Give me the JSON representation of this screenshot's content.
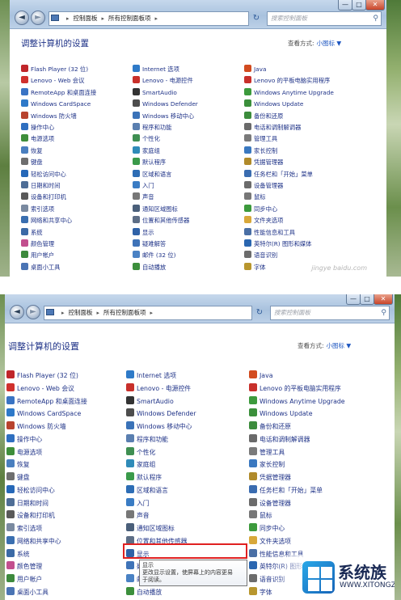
{
  "nav": {
    "crumbs": [
      "控制面板",
      "所有控制面板项"
    ],
    "search_placeholder": "搜索控制面板"
  },
  "header": {
    "title": "调整计算机的设置",
    "view_label": "查看方式:",
    "view_value": "小图标",
    "view_arrow": "▼"
  },
  "columns": [
    [
      {
        "label": "Flash Player (32 位)",
        "icon": "flash-player-icon",
        "color": "#c0262a"
      },
      {
        "label": "Lenovo - Web 会议",
        "icon": "lenovo-web-meeting-icon",
        "color": "#d0312d"
      },
      {
        "label": "RemoteApp 和桌面连接",
        "icon": "remoteapp-icon",
        "color": "#3a74c4"
      },
      {
        "label": "Windows CardSpace",
        "icon": "cardspace-icon",
        "color": "#2e79c9"
      },
      {
        "label": "Windows 防火墙",
        "icon": "firewall-icon",
        "color": "#b8432e"
      },
      {
        "label": "操作中心",
        "icon": "action-center-icon",
        "color": "#2f6fc0"
      },
      {
        "label": "电源选项",
        "icon": "power-options-icon",
        "color": "#3e8e3a"
      },
      {
        "label": "恢复",
        "icon": "recovery-icon",
        "color": "#4a7fbf"
      },
      {
        "label": "键盘",
        "icon": "keyboard-icon",
        "color": "#6e6e6e"
      },
      {
        "label": "轻松访问中心",
        "icon": "ease-of-access-icon",
        "color": "#2668b8"
      },
      {
        "label": "日期和时间",
        "icon": "date-time-icon",
        "color": "#4e6d96"
      },
      {
        "label": "设备和打印机",
        "icon": "devices-printers-icon",
        "color": "#595959"
      },
      {
        "label": "索引选项",
        "icon": "indexing-icon",
        "color": "#7a8aa0"
      },
      {
        "label": "网络和共享中心",
        "icon": "network-sharing-icon",
        "color": "#3a6fb0"
      },
      {
        "label": "系统",
        "icon": "system-icon",
        "color": "#3b6aa6"
      },
      {
        "label": "颜色管理",
        "icon": "color-management-icon",
        "color": "#c24f8e"
      },
      {
        "label": "用户帐户",
        "icon": "user-accounts-icon",
        "color": "#3d8a3d"
      },
      {
        "label": "桌面小工具",
        "icon": "gadgets-icon",
        "color": "#4a74b4"
      }
    ],
    [
      {
        "label": "Internet 选项",
        "icon": "internet-options-icon",
        "color": "#2e7ac8"
      },
      {
        "label": "Lenovo - 电源控件",
        "icon": "lenovo-power-icon",
        "color": "#c8302b"
      },
      {
        "label": "SmartAudio",
        "icon": "smartaudio-icon",
        "color": "#333333"
      },
      {
        "label": "Windows Defender",
        "icon": "defender-icon",
        "color": "#4d4d4d"
      },
      {
        "label": "Windows 移动中心",
        "icon": "mobility-center-icon",
        "color": "#3a72b8"
      },
      {
        "label": "程序和功能",
        "icon": "programs-features-icon",
        "color": "#5a7fb0"
      },
      {
        "label": "个性化",
        "icon": "personalization-icon",
        "color": "#3f8f52"
      },
      {
        "label": "家庭组",
        "icon": "homegroup-icon",
        "color": "#2f8bb8"
      },
      {
        "label": "默认程序",
        "icon": "default-programs-icon",
        "color": "#3a9a4a"
      },
      {
        "label": "区域和语言",
        "icon": "region-language-icon",
        "color": "#2d6db5"
      },
      {
        "label": "入门",
        "icon": "getting-started-icon",
        "color": "#3a7cc4"
      },
      {
        "label": "声音",
        "icon": "sound-icon",
        "color": "#777777"
      },
      {
        "label": "通知区域图标",
        "icon": "notification-icons-icon",
        "color": "#4a5f7a"
      },
      {
        "label": "位置和其他传感器",
        "icon": "location-sensors-icon",
        "color": "#5d6e86"
      },
      {
        "label": "显示",
        "icon": "display-icon",
        "color": "#2f62a8"
      },
      {
        "label": "疑难解答",
        "icon": "troubleshooting-icon",
        "color": "#3f73b8"
      },
      {
        "label": "邮件 (32 位)",
        "icon": "mail-icon",
        "color": "#4a82c4"
      },
      {
        "label": "自动播放",
        "icon": "autoplay-icon",
        "color": "#3c8f3c"
      }
    ],
    [
      {
        "label": "Java",
        "icon": "java-icon",
        "color": "#d24b1f"
      },
      {
        "label": "Lenovo 的平板电脑实用程序",
        "icon": "lenovo-tablet-icon",
        "color": "#c8302b"
      },
      {
        "label": "Windows Anytime Upgrade",
        "icon": "anytime-upgrade-icon",
        "color": "#3c9a3c"
      },
      {
        "label": "Windows Update",
        "icon": "windows-update-icon",
        "color": "#3b8f3b"
      },
      {
        "label": "备份和还原",
        "icon": "backup-restore-icon",
        "color": "#3c8c3c"
      },
      {
        "label": "电话和调制解调器",
        "icon": "phone-modem-icon",
        "color": "#6a6a6a"
      },
      {
        "label": "管理工具",
        "icon": "admin-tools-icon",
        "color": "#7a7a7a"
      },
      {
        "label": "家长控制",
        "icon": "parental-controls-icon",
        "color": "#3a78c0"
      },
      {
        "label": "凭据管理器",
        "icon": "credential-manager-icon",
        "color": "#b08a2a"
      },
      {
        "label": "任务栏和「开始」菜单",
        "icon": "taskbar-start-icon",
        "color": "#3a6cb0"
      },
      {
        "label": "设备管理器",
        "icon": "device-manager-icon",
        "color": "#6b6b6b"
      },
      {
        "label": "鼠标",
        "icon": "mouse-icon",
        "color": "#777777"
      },
      {
        "label": "同步中心",
        "icon": "sync-center-icon",
        "color": "#3c9a3c"
      },
      {
        "label": "文件夹选项",
        "icon": "folder-options-icon",
        "color": "#d8a83a"
      },
      {
        "label": "性能信息和工具",
        "icon": "performance-icon",
        "color": "#4a6fa5"
      },
      {
        "label": "英特尔(R) 图形和媒体",
        "icon": "intel-graphics-icon",
        "color": "#2a66b0"
      },
      {
        "label": "语音识别",
        "icon": "speech-recognition-icon",
        "color": "#6c6c6c"
      },
      {
        "label": "字体",
        "icon": "fonts-icon",
        "color": "#b8962e"
      }
    ]
  ],
  "tooltip": {
    "title": "显示",
    "line1": "更改显示设置，使屏幕上的内容更易",
    "line2": "于阅读。"
  },
  "watermark1": "jingye  baidu.com",
  "watermark2": {
    "name": "系统族",
    "url": "WWW.XITONGZU.COM"
  },
  "window_buttons": {
    "min": "—",
    "max": "□",
    "close": "✕"
  },
  "nav_glyphs": {
    "back": "◄",
    "forward": "►",
    "refresh": "↻",
    "search": "⚲",
    "dropdown": "▾"
  }
}
